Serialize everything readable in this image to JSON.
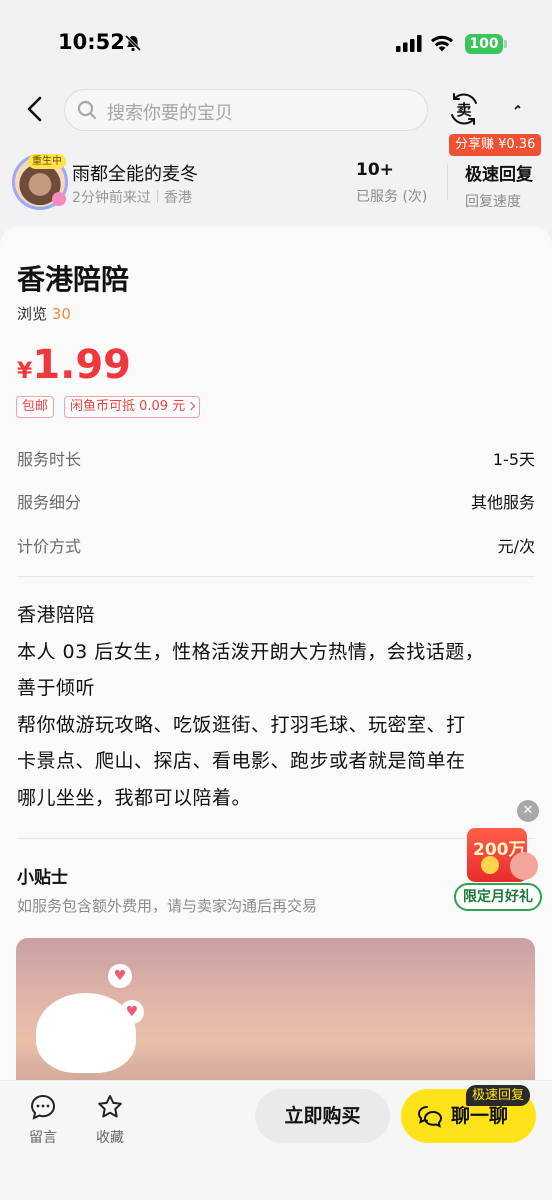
{
  "status_bar": {
    "time": "10:52",
    "battery": "100"
  },
  "nav": {
    "search_placeholder": "搜索你要的宝贝",
    "share_earn": "分享赚 ¥0.36"
  },
  "seller": {
    "name": "雨都全能的麦冬",
    "avatar_badge": "重生中",
    "last_seen": "2分钟前来过",
    "location": "香港",
    "served_value": "10+",
    "served_label": "已服务 (次)",
    "reply_value": "极速回复",
    "reply_label": "回复速度"
  },
  "product": {
    "title": "香港陪陪",
    "views_label": "浏览",
    "views_count": "30",
    "currency": "¥",
    "price": "1.99",
    "tags": [
      "包邮",
      "闲鱼币可抵 0.09 元"
    ]
  },
  "attributes": [
    {
      "key": "服务时长",
      "value": "1-5天"
    },
    {
      "key": "服务细分",
      "value": "其他服务"
    },
    {
      "key": "计价方式",
      "value": "元/次"
    }
  ],
  "description": [
    "香港陪陪",
    "本人 03 后女生，性格活泼开朗大方热情，会找话题，",
    "善于倾听",
    "帮你做游玩攻略、吃饭逛街、打羽毛球、玩密室、打",
    "卡景点、爬山、探店、看电影、跑步或者就是简单在",
    "哪儿坐坐，我都可以陪着。"
  ],
  "tips": {
    "title": "小贴士",
    "text": "如服务包含额外费用，请与卖家沟通后再交易"
  },
  "promo": {
    "amount": "200万",
    "label": "限定月好礼"
  },
  "bottom_bar": {
    "comment": "留言",
    "favorite": "收藏",
    "buy": "立即购买",
    "chat": "聊一聊",
    "chat_badge": "极速回复"
  },
  "colors": {
    "price": "#f0373b",
    "chat_button": "#ffe31a",
    "share_badge": "#f05133",
    "views_count": "#f28a3e"
  }
}
